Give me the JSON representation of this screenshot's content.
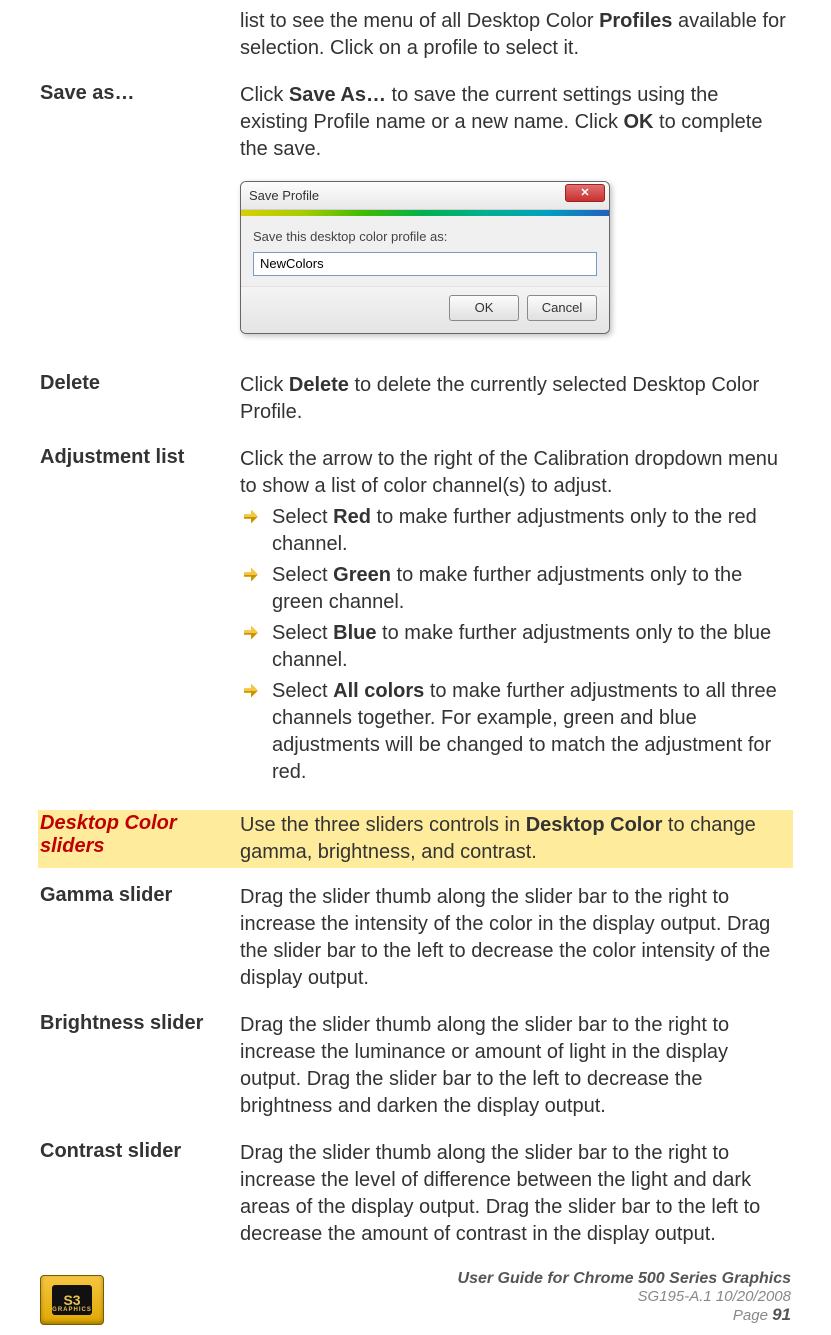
{
  "intro": {
    "text_pre": "list to see the menu of all Desktop Color ",
    "bold1": "Profiles",
    "text_post": " available for selection. Click on a profile to select it."
  },
  "save_as": {
    "label": "Save as…",
    "p1_pre": "Click ",
    "p1_b1": "Save As…",
    "p1_mid": " to save the current settings using the existing Profile name or a new name. Click ",
    "p1_b2": "OK",
    "p1_post": " to complete the save."
  },
  "dialog": {
    "title": "Save Profile",
    "prompt": "Save this desktop color profile as:",
    "value": "NewColors",
    "ok": "OK",
    "cancel": "Cancel",
    "close_aria": "Close"
  },
  "delete": {
    "label": "Delete",
    "p_pre": "Click ",
    "p_b": "Delete",
    "p_post": " to delete the currently selected Desktop Color Profile."
  },
  "adjustment": {
    "label": "Adjustment list",
    "intro": "Click the arrow to the right of the Calibration dropdown menu to show a list of color channel(s) to adjust.",
    "items": [
      {
        "pre": "Select ",
        "b": "Red",
        "post": " to make further adjustments only to the red channel."
      },
      {
        "pre": "Select ",
        "b": "Green",
        "post": " to make further adjustments only to the green channel."
      },
      {
        "pre": "Select ",
        "b": "Blue",
        "post": " to make further adjustments only to the blue channel."
      },
      {
        "pre": "Select ",
        "b": "All colors",
        "post": " to make further adjustments to all three channels together. For example, green and blue adjustments will be changed to match the adjustment for red."
      }
    ]
  },
  "sliders_header": {
    "label": "Desktop Color sliders",
    "p_pre": "Use the three sliders controls in ",
    "p_b": "Desktop Color",
    "p_post": " to change gamma, brightness, and contrast."
  },
  "gamma": {
    "label": "Gamma slider",
    "text": "Drag the slider thumb along the slider bar to the right to increase the intensity of the color in the display output. Drag the slider bar to the left to decrease the color intensity of the display output."
  },
  "brightness": {
    "label": "Brightness slider",
    "text": "Drag the slider thumb along the slider bar to the right to increase the luminance or amount of light in the display output. Drag the slider bar to the left to decrease the brightness and darken the display output."
  },
  "contrast": {
    "label": "Contrast slider",
    "text": "Drag the slider thumb along the slider bar to the right to increase the level of difference between the light and dark areas of the display output. Drag the slider bar to the left to decrease the amount of contrast in the display output."
  },
  "footer": {
    "logo_text": "S3",
    "logo_sub": "GRAPHICS",
    "line1": "User Guide for Chrome 500 Series Graphics",
    "line2": "SG195-A.1   10/20/2008",
    "line3_pre": "Page ",
    "page": "91"
  }
}
